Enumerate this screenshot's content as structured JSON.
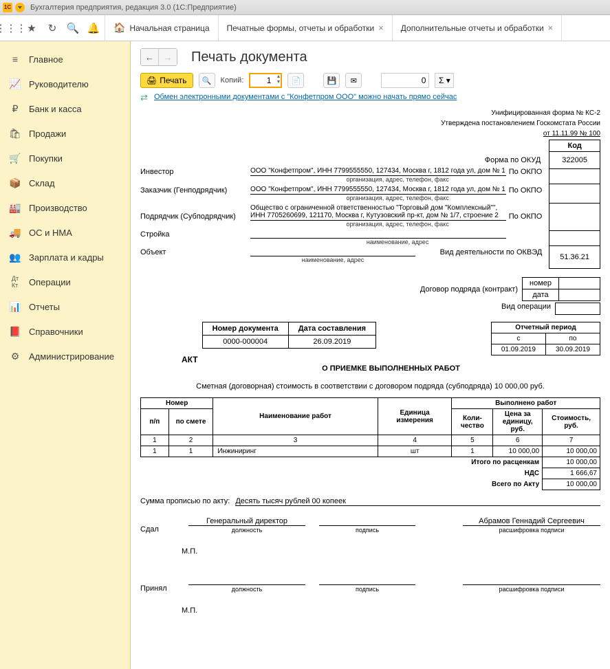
{
  "app": {
    "title": "Бухгалтерия предприятия, редакция 3.0  (1С:Предприятие)"
  },
  "tabs": {
    "home": "Начальная страница",
    "t1": "Печатные формы, отчеты и обработки",
    "t2": "Дополнительные отчеты и обработки"
  },
  "sidebar": {
    "items": [
      {
        "label": "Главное"
      },
      {
        "label": "Руководителю"
      },
      {
        "label": "Банк и касса"
      },
      {
        "label": "Продажи"
      },
      {
        "label": "Покупки"
      },
      {
        "label": "Склад"
      },
      {
        "label": "Производство"
      },
      {
        "label": "ОС и НМА"
      },
      {
        "label": "Зарплата и кадры"
      },
      {
        "label": "Операции"
      },
      {
        "label": "Отчеты"
      },
      {
        "label": "Справочники"
      },
      {
        "label": "Администрирование"
      }
    ]
  },
  "page": {
    "title": "Печать документа",
    "print_label": "Печать",
    "copies_label": "Копий:",
    "copies_value": "1",
    "num_value": "0",
    "edo_link": "Обмен электронными документами с \"Конфетпром ООО\" можно начать прямо сейчас"
  },
  "doc": {
    "form_header1": "Унифицированная форма № КС-2",
    "form_header2": "Утверждена постановлением  Госкомстата России",
    "form_header3": "от 11.11.99 № 100",
    "code_label": "Код",
    "okud_label": "Форма по ОКУД",
    "okud_value": "322005",
    "okpo_label": "По ОКПО",
    "investor_label": "Инвестор",
    "investor_value": "ООО \"Конфетпром\", ИНН 7799555550, 127434, Москва г, 1812 года ул, дом № 1",
    "org_sub": "организация, адрес, телефон, факс",
    "customer_label": "Заказчик (Генподрядчик)",
    "customer_value": "ООО \"Конфетпром\", ИНН 7799555550, 127434, Москва г, 1812 года ул, дом № 1",
    "contractor_label": "Подрядчик (Субподрядчик)",
    "contractor_value": "Общество с ограниченной ответственностью \"Торговый дом \"Комплексный\"\", ИНН 7705260699, 121170, Москва г, Кутузовский пр-кт, дом № 1/7, строение 2",
    "stroyka_label": "Стройка",
    "stroyka_sub": "наименование, адрес",
    "object_label": "Объект",
    "object_sub": "наименование, адрес",
    "kved_label": "Вид деятельности по ОКВЭД",
    "kved_value": "51.36.21",
    "contract_label": "Договор подряда (контракт)",
    "contract_num_lbl": "номер",
    "contract_date_lbl": "дата",
    "vid_op_label": "Вид операции",
    "akt_title": "АКТ",
    "akt_sub": "О ПРИЕМКЕ ВЫПОЛНЕННЫХ РАБОТ",
    "docnum_hdr": "Номер документа",
    "docdate_hdr": "Дата составления",
    "docnum": "0000-000004",
    "docdate": "26.09.2019",
    "period_hdr": "Отчетный период",
    "period_from_lbl": "с",
    "period_to_lbl": "по",
    "period_from": "01.09.2019",
    "period_to": "30.09.2019",
    "smeta_line": "Сметная (договорная) стоимость в соответствии с договором подряда (субподряда) 10 000,00 руб.",
    "tbl_headers": {
      "nomer": "Номер",
      "pp": "п/п",
      "posmete": "по смете",
      "name": "Наименование работ",
      "unit": "Единица измерения",
      "done": "Выполнено работ",
      "qty": "Коли-чество",
      "price": "Цена за единицу, руб.",
      "cost": "Стоимость, руб."
    },
    "rows": [
      {
        "pp": "1",
        "ps": "1",
        "name": "Инжиниринг",
        "unit": "шт",
        "qty": "1",
        "price": "10 000,00",
        "cost": "10 000,00"
      }
    ],
    "totals": {
      "itogo_lbl": "Итого по расценкам",
      "itogo_val": "10 000,00",
      "nds_lbl": "НДС",
      "nds_val": "1 666,67",
      "vsego_lbl": "Всего по Акту",
      "vsego_val": "10 000,00"
    },
    "sum_propis_lbl": "Сумма прописью по акту:",
    "sum_propis": "Десять тысяч рублей 00 копеек",
    "sdal_lbl": "Сдал",
    "sdal_pos": "Генеральный директор",
    "sdal_fio": "Абрамов Геннадий Сергеевич",
    "pos_sub": "должность",
    "sign_sub": "подпись",
    "fio_sub": "расшифровка подписи",
    "mp": "М.П.",
    "prinyal_lbl": "Принял"
  }
}
